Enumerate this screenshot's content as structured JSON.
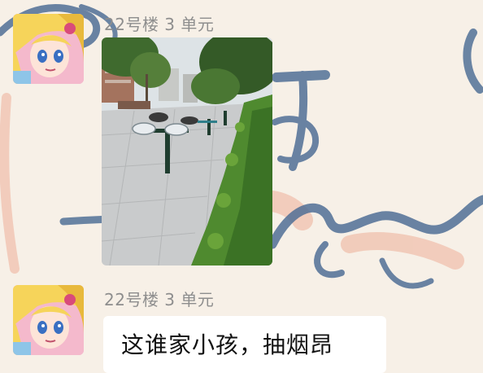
{
  "chat": {
    "messages": [
      {
        "sender": "22号楼 3 单元",
        "type": "image",
        "avatar_icon": "anime-girl-avatar-icon",
        "image_subject": "park-fitness-equipment-photo"
      },
      {
        "sender": "22号楼 3 单元",
        "type": "text",
        "avatar_icon": "anime-girl-avatar-icon",
        "text": "这谁家小孩，抽烟昂"
      }
    ]
  },
  "colors": {
    "wallpaper_base": "#f7f0e7",
    "wallpaper_stroke": "#4a6b94",
    "wallpaper_accent": "#f1c6b4",
    "sender_name": "#8e8e8e",
    "bubble": "#ffffff",
    "message_text": "#111111"
  }
}
